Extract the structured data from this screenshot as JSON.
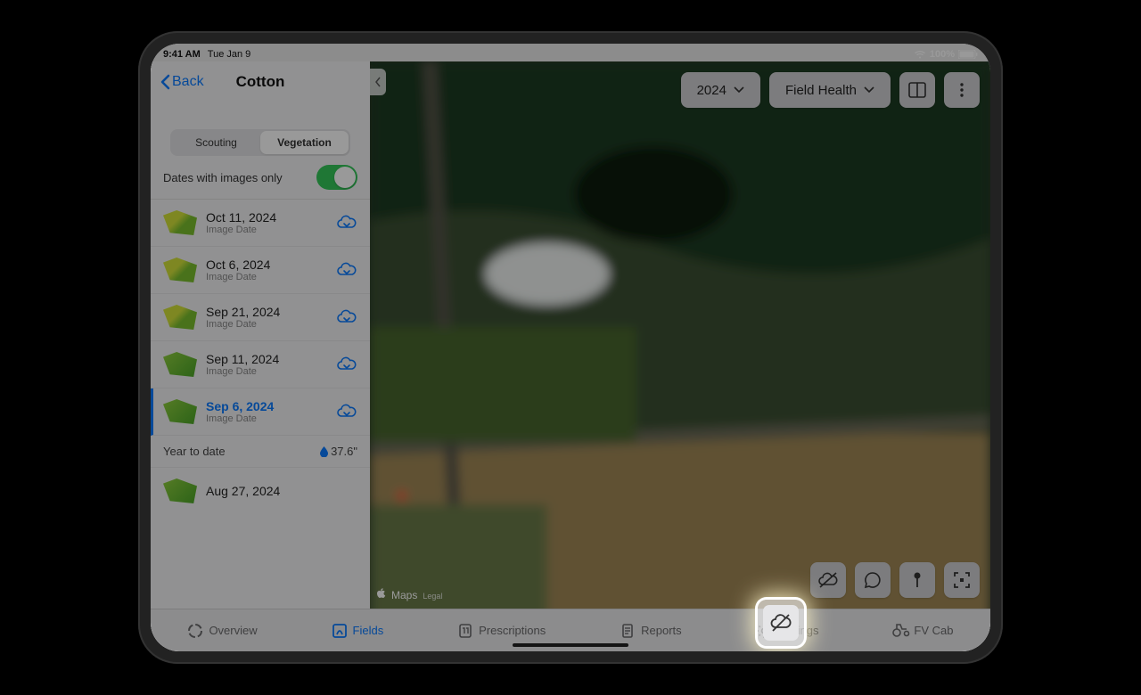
{
  "status": {
    "time": "9:41 AM",
    "date": "Tue Jan 9",
    "battery": "100%"
  },
  "nav": {
    "back": "Back",
    "title": "Cotton"
  },
  "segments": {
    "scouting": "Scouting",
    "vegetation": "Vegetation"
  },
  "filter": {
    "label": "Dates with images only"
  },
  "dates": [
    {
      "date": "Oct 11, 2024",
      "sub": "Image Date"
    },
    {
      "date": "Oct 6, 2024",
      "sub": "Image Date"
    },
    {
      "date": "Sep 21, 2024",
      "sub": "Image Date"
    },
    {
      "date": "Sep 11, 2024",
      "sub": "Image Date"
    },
    {
      "date": "Sep 6, 2024",
      "sub": "Image Date"
    },
    {
      "date": "Aug 27, 2024",
      "sub": ""
    }
  ],
  "ytd": {
    "label": "Year to date",
    "rain": "37.6\""
  },
  "map": {
    "year": "2024",
    "layer": "Field Health",
    "attr": "Maps",
    "legal": "Legal"
  },
  "tabs": {
    "overview": "Overview",
    "fields": "Fields",
    "prescriptions": "Prescriptions",
    "reports": "Reports",
    "settings": "Settings",
    "fvcab": "FV Cab"
  }
}
